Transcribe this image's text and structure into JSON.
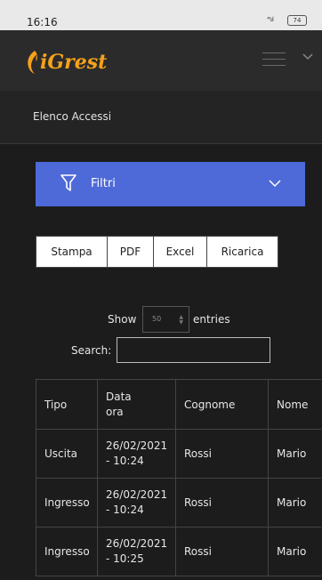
{
  "status": {
    "time": "16:16",
    "signal": "⁴⁶ₗ.ıl",
    "battery": "74"
  },
  "app": {
    "logo_text": "iGrest"
  },
  "page": {
    "title": "Elenco Accessi"
  },
  "filters": {
    "label": "Filtri"
  },
  "export_buttons": [
    {
      "label": "Stampa"
    },
    {
      "label": "PDF"
    },
    {
      "label": "Excel"
    },
    {
      "label": "Ricarica"
    }
  ],
  "length": {
    "show_label": "Show",
    "value": "50",
    "entries_label": "entries"
  },
  "search": {
    "label": "Search:",
    "value": ""
  },
  "table": {
    "headers": [
      "Tipo",
      "Data ora",
      "Cognome",
      "Nome"
    ],
    "rows": [
      {
        "tipo": "Uscita",
        "data_ora": "26/02/2021 - 10:24",
        "cognome": "Rossi",
        "nome": "Mario"
      },
      {
        "tipo": "Ingresso",
        "data_ora": "26/02/2021 - 10:24",
        "cognome": "Rossi",
        "nome": "Mario"
      },
      {
        "tipo": "Ingresso",
        "data_ora": "26/02/2021 - 10:25",
        "cognome": "Rossi",
        "nome": "Mario"
      }
    ]
  },
  "colors": {
    "accent": "#4e6ad8",
    "brand": "#f6a21a",
    "background": "#1c1c1c"
  }
}
